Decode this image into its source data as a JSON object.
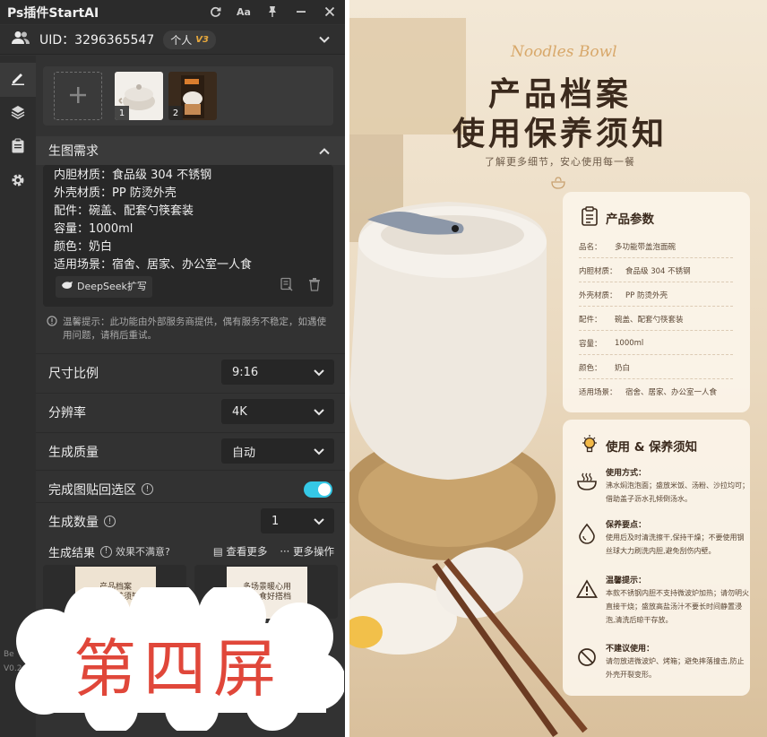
{
  "window": {
    "title": "Ps插件StartAI"
  },
  "user": {
    "uid_text": "UID：3296365547",
    "tier_label": "个人",
    "tier_version": "V3"
  },
  "upload": {
    "thumbs": [
      {
        "index": "1"
      },
      {
        "index": "2"
      }
    ]
  },
  "requirements": {
    "title": "生图需求",
    "lines": [
      "内胆材质：食品级 304 不锈钢",
      "外壳材质：PP 防烫外壳",
      "配件：碗盖、配套勺筷套装",
      "容量：1000ml",
      "颜色：奶白",
      "适用场景：宿舍、居家、办公室一人食"
    ],
    "deepseek_label": "DeepSeek扩写"
  },
  "hint": {
    "text": "温馨提示：此功能由外部服务商提供，偶有服务不稳定，如遇使用问题，请稍后重试。"
  },
  "settings": {
    "ratio_label": "尺寸比例",
    "ratio_value": "9:16",
    "resolution_label": "分辨率",
    "resolution_value": "4K",
    "quality_label": "生成质量",
    "quality_value": "自动",
    "paste_back_label": "完成图贴回选区",
    "count_label": "生成数量",
    "count_value": "1"
  },
  "results": {
    "title": "生成结果",
    "unsatisfied": "效果不满意?",
    "view_more": "查看更多",
    "more_actions": "更多操作",
    "thumb1": "产品档案\n使用保养须知",
    "thumb2": "多场景暖心用\n一人食好搭档"
  },
  "version": {
    "line1": "Be",
    "line2": "V0.2"
  },
  "overlay": {
    "text": "第四屏"
  },
  "poster": {
    "brand": "Noodles Bowl",
    "title1": "产品档案",
    "title2": "使用保养须知",
    "subtitle": "了解更多细节，安心使用每一餐",
    "params_title": "产品参数",
    "params": [
      {
        "k": "品名：",
        "v": "多功能带盖泡面碗"
      },
      {
        "k": "内胆材质：",
        "v": "食品级 304 不锈钢"
      },
      {
        "k": "外壳材质：",
        "v": "PP 防烫外壳"
      },
      {
        "k": "配件：",
        "v": "碗盖、配套勺筷套装"
      },
      {
        "k": "容量：",
        "v": "1000ml"
      },
      {
        "k": "颜色：",
        "v": "奶白"
      },
      {
        "k": "适用场景：",
        "v": "宿舍、居家、办公室一人食"
      }
    ],
    "care_title": "使用 & 保养须知",
    "care": [
      {
        "icon": "bowl-steam-icon",
        "title": "使用方式：",
        "body": "沸水焖泡泡面；盛放米饭、汤粉、沙拉均可；借助盖子沥水孔倾倒汤水。"
      },
      {
        "icon": "water-drop-icon",
        "title": "保养要点：",
        "body": "使用后及时清洗擦干,保持干燥；不要使用钢丝球大力刷洗内胆,避免刮伤内壁。"
      },
      {
        "icon": "warning-icon",
        "title": "温馨提示：",
        "body": "本款不锈钢内胆不支持微波炉加热；请勿明火直接干烧；盛放高盐汤汁不要长时间静置浸泡,清洗后晾干存放。"
      },
      {
        "icon": "prohibited-icon",
        "title": "不建议使用：",
        "body": "请勿放进微波炉、烤箱；避免摔落撞击,防止外壳开裂变形。"
      }
    ]
  }
}
